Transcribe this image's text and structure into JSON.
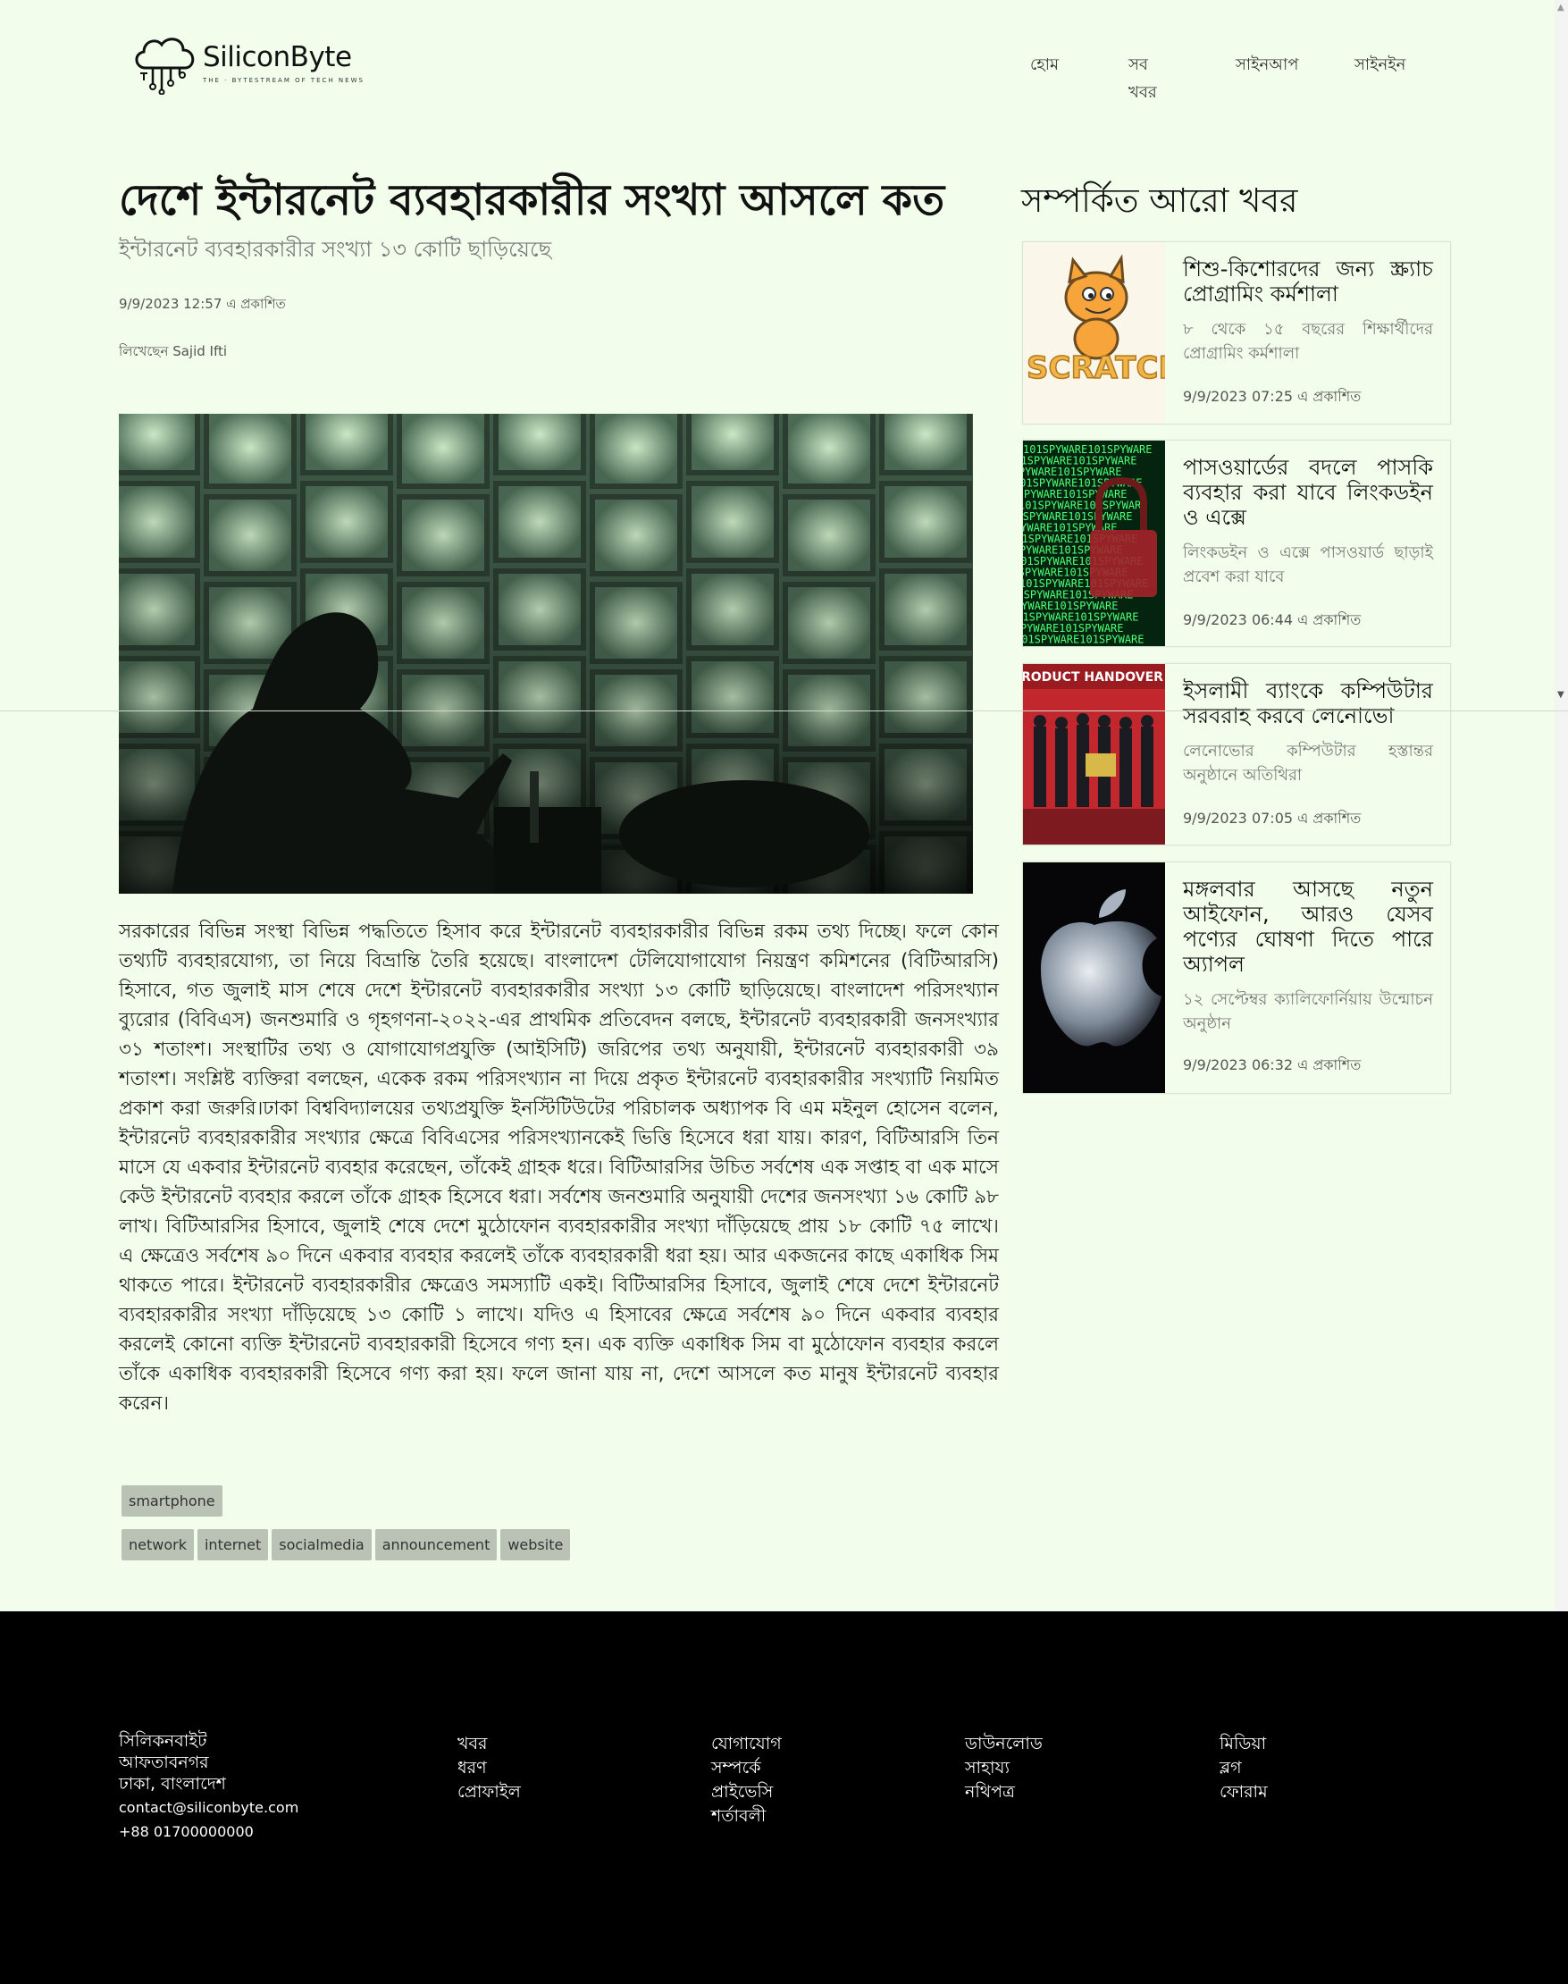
{
  "header": {
    "logo_name": "SiliconByte",
    "logo_tagline": "THE · BYTESTREAM OF TECH NEWS",
    "nav": [
      "হোম",
      "সব খবর",
      "সাইনআপ",
      "সাইনইন"
    ]
  },
  "article": {
    "title": "দেশে ইন্টারনেট ব্যবহারকারীর সংখ্যা আসলে কত",
    "subtitle": "ইন্টারনেট ব্যবহারকারীর সংখ্যা ১৩ কোটি ছাড়িয়েছে",
    "published": "9/9/2023 12:57 এ প্রকাশিত",
    "author_label": "লিখেছেন",
    "author": "Sajid Ifti",
    "body": "সরকারের বিভিন্ন সংস্থা বিভিন্ন পদ্ধতিতে হিসাব করে ইন্টারনেট ব্যবহারকারীর বিভিন্ন রকম তথ্য দিচ্ছে। ফলে কোন তথ্যটি ব্যবহারযোগ্য, তা নিয়ে বিভ্রান্তি তৈরি হয়েছে। বাংলাদেশ টেলিযোগাযোগ নিয়ন্ত্রণ কমিশনের (বিটিআরসি) হিসাবে, গত জুলাই মাস শেষে দেশে ইন্টারনেট ব্যবহারকারীর সংখ্যা ১৩ কোটি ছাড়িয়েছে। বাংলাদেশ পরিসংখ্যান ব্যুরোর (বিবিএস) জনশুমারি ও গৃহগণনা-২০২২-এর প্রাথমিক প্রতিবেদন বলছে, ইন্টারনেট ব্যবহারকারী জনসংখ্যার ৩১ শতাংশ। সংস্থাটির তথ্য ও যোগাযোগপ্রযুক্তি (আইসিটি) জরিপের তথ্য অনুযায়ী, ইন্টারনেট ব্যবহারকারী ৩৯ শতাংশ। সংশ্লিষ্ট ব্যক্তিরা বলছেন, একেক রকম পরিসংখ্যান না দিয়ে প্রকৃত ইন্টারনেট ব্যবহারকারীর সংখ্যাটি নিয়মিত প্রকাশ করা জরুরি।ঢাকা বিশ্ববিদ্যালয়ের তথ্যপ্রযুক্তি ইনস্টিটিউটের পরিচালক অধ্যাপক বি এম মইনুল হোসেন বলেন, ইন্টারনেট ব্যবহারকারীর সংখ্যার ক্ষেত্রে বিবিএসের পরিসংখ্যানকেই ভিত্তি হিসেবে ধরা যায়। কারণ, বিটিআরসি তিন মাসে যে একবার ইন্টারনেট ব্যবহার করেছেন, তাঁকেই গ্রাহক ধরে। বিটিআরসির উচিত সর্বশেষ এক সপ্তাহ বা এক মাসে কেউ ইন্টারনেট ব্যবহার করলে তাঁকে গ্রাহক হিসেবে ধরা। সর্বশেষ জনশুমারি অনুযায়ী দেশের জনসংখ্যা ১৬ কোটি ৯৮ লাখ। বিটিআরসির হিসাবে, জুলাই শেষে দেশে মুঠোফোন ব্যবহারকারীর সংখ্যা দাঁড়িয়েছে প্রায় ১৮ কোটি ৭৫ লাখে। এ ক্ষেত্রেও সর্বশেষ ৯০ দিনে একবার ব্যবহার করলেই তাঁকে ব্যবহারকারী ধরা হয়। আর একজনের কাছে একাধিক সিম থাকতে পারে। ইন্টারনেট ব্যবহারকারীর ক্ষেত্রেও সমস্যাটি একই। বিটিআরসির হিসাবে, জুলাই শেষে দেশে ইন্টারনেট ব্যবহারকারীর সংখ্যা দাঁড়িয়েছে ১৩ কোটি ১ লাখে। যদিও এ হিসাবের ক্ষেত্রে সর্বশেষ ৯০ দিনে একবার ব্যবহার করলেই কোনো ব্যক্তি ইন্টারনেট ব্যবহারকারী হিসেবে গণ্য হন। এক ব্যক্তি একাধিক সিম বা মুঠোফোন ব্যবহার করলে তাঁকে একাধিক ব্যবহারকারী হিসেবে গণ্য করা হয়। ফলে জানা যায় না, দেশে আসলে কত মানুষ ইন্টারনেট ব্যবহার করেন।",
    "tags_row1": [
      "smartphone"
    ],
    "tags_row2": [
      "network",
      "internet",
      "socialmedia",
      "announcement",
      "website"
    ]
  },
  "sidebar": {
    "title": "সম্পর্কিত আরো খবর",
    "cards": [
      {
        "title": "শিশু-কিশোরদের জন্য স্ক্র্যাচ প্রোগ্রামিং কর্মশালা",
        "desc": "৮ থেকে ১৫ বছরের শিক্ষার্থীদের প্রোগ্রামিং কর্মশালা",
        "date": "9/9/2023 07:25 এ প্রকাশিত",
        "thumb_text": "SCRATCH"
      },
      {
        "title": "পাসওয়ার্ডের বদলে পাসকি ব্যবহার করা যাবে লিংকডইন ও এক্সে",
        "desc": "লিংকডইন ও এক্সে পাসওয়ার্ড ছাড়াই প্রবেশ করা যাবে",
        "date": "9/9/2023 06:44 এ প্রকাশিত",
        "thumb_text": "101SPYWARE"
      },
      {
        "title": "ইসলামী ব্যাংকে কম্পিউটার সরবরাহ করবে লেনোভো",
        "desc": "লেনোভোর কম্পিউটার হস্তান্তর অনুষ্ঠানে অতিথিরা",
        "date": "9/9/2023 07:05 এ প্রকাশিত",
        "thumb_text": "RODUCT HANDOVER"
      },
      {
        "title": "মঙ্গলবার আসছে নতুন আইফোন, আরও যেসব পণ্যের ঘোষণা দিতে পারে অ্যাপল",
        "desc": "১২ সেপ্টেম্বর ক্যালিফোর্নিয়ায় উন্মোচন অনুষ্ঠান",
        "date": "9/9/2023 06:32 এ প্রকাশিত",
        "thumb_text": ""
      }
    ]
  },
  "footer": {
    "address": [
      "সিলিকনবাইট",
      "আফতাবনগর",
      "ঢাকা, বাংলাদেশ"
    ],
    "email": "contact@siliconbyte.com",
    "phone": "+88 01700000000",
    "col2": [
      "খবর",
      "ধরণ",
      "প্রোফাইল"
    ],
    "col3": [
      "যোগাযোগ",
      "সম্পর্কে",
      "প্রাইভেসি",
      "শর্তাবলী"
    ],
    "col4": [
      "ডাউনলোড",
      "সাহায্য",
      "নথিপত্র"
    ],
    "col5": [
      "মিডিয়া",
      "ব্লগ",
      "ফোরাম"
    ]
  }
}
